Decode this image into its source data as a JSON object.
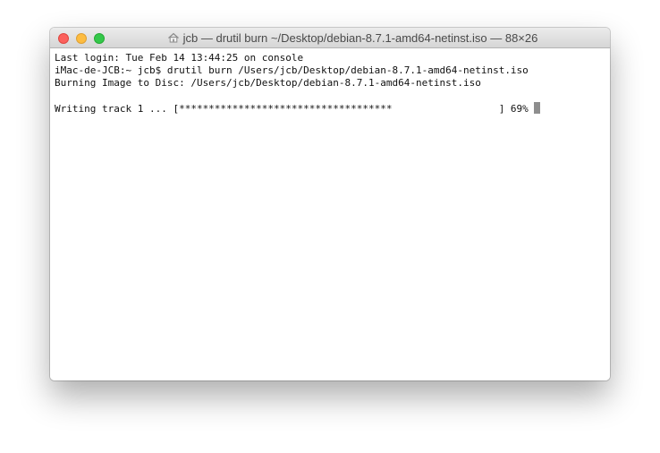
{
  "window": {
    "title": "jcb — drutil burn ~/Desktop/debian-8.7.1-amd64-netinst.iso — 88×26",
    "title_icon": "home-folder-icon"
  },
  "terminal": {
    "lines": [
      "Last login: Tue Feb 14 13:44:25 on console",
      "iMac-de-JCB:~ jcb$ drutil burn /Users/jcb/Desktop/debian-8.7.1-amd64-netinst.iso",
      "Burning Image to Disc: /Users/jcb/Desktop/debian-8.7.1-amd64-netinst.iso",
      "",
      "Writing track 1 ... [************************************                  ] 69%"
    ]
  },
  "colors": {
    "close": "#fc605c",
    "minimize": "#fdbc40",
    "zoom": "#34c84a",
    "cursor": "#8e8e8e"
  }
}
